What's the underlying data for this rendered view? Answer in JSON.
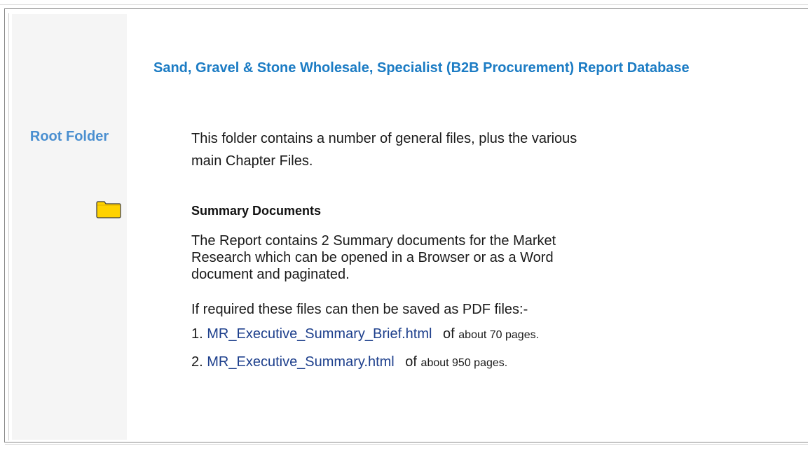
{
  "sidebar": {
    "title": "Root Folder",
    "folder_icon": "folder-icon",
    "folder_color": "#ffd200"
  },
  "main": {
    "report_title": "Sand, Gravel & Stone Wholesale, Specialist (B2B Procurement) Report Database",
    "intro_line1": "This folder contains a number of general files, plus the various",
    "intro_line2": "main Chapter Files.",
    "summary_heading": "Summary Documents",
    "summary_desc": "The Report contains 2 Summary documents for the Market Research which can be opened in a Browser or as a Word document and paginated.",
    "pdf_note": "If required these files can then be saved as PDF files:-",
    "documents": [
      {
        "num": "1.",
        "link": "MR_Executive_Summary_Brief.html",
        "of": "of",
        "pages": "about 70 pages."
      },
      {
        "num": "2.",
        "link": "MR_Executive_Summary.html",
        "of": "of",
        "pages": "about 950 pages."
      }
    ]
  },
  "colors": {
    "sidebar_title": "#4a8fd0",
    "report_title": "#1c7cc4",
    "link": "#1d3f8c",
    "sidebar_bg": "#f5f5f5"
  }
}
